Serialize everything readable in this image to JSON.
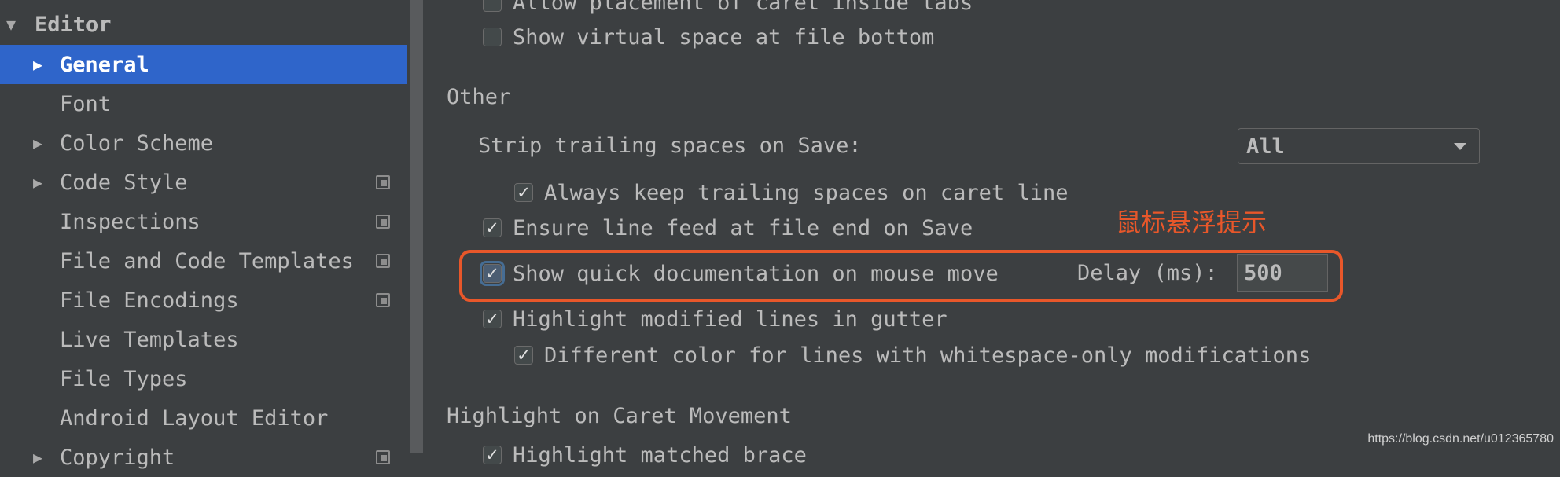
{
  "sidebar": {
    "editor_label": "Editor",
    "items": [
      {
        "label": "General"
      },
      {
        "label": "Font"
      },
      {
        "label": "Color Scheme"
      },
      {
        "label": "Code Style"
      },
      {
        "label": "Inspections"
      },
      {
        "label": "File and Code Templates"
      },
      {
        "label": "File Encodings"
      },
      {
        "label": "Live Templates"
      },
      {
        "label": "File Types"
      },
      {
        "label": "Android Layout Editor"
      },
      {
        "label": "Copyright"
      }
    ]
  },
  "content": {
    "top_options": [
      {
        "label": "Allow placement of caret inside tabs",
        "checked": false
      },
      {
        "label": "Show virtual space at file bottom",
        "checked": false
      }
    ],
    "other": {
      "title": "Other",
      "strip_label": "Strip trailing spaces on Save:",
      "strip_value": "All",
      "keep_trailing": {
        "label": "Always keep trailing spaces on caret line",
        "checked": true
      },
      "ensure_line_feed": {
        "label": "Ensure line feed at file end on Save",
        "checked": true
      },
      "quick_doc": {
        "label": "Show quick documentation on mouse move",
        "checked": true
      },
      "delay_label": "Delay (ms):",
      "delay_value": "500",
      "highlight_modified": {
        "label": "Highlight modified lines in gutter",
        "checked": true
      },
      "different_color": {
        "label": "Different color for lines with whitespace-only modifications",
        "checked": true
      }
    },
    "caret_section": {
      "title": "Highlight on Caret Movement",
      "matched_brace": {
        "label": "Highlight matched brace",
        "checked": true
      }
    }
  },
  "annotation": "鼠标悬浮提示",
  "watermark": "https://blog.csdn.net/u012365780",
  "colors": {
    "selection": "#2f65ca",
    "annotation": "#e8572a",
    "background": "#3c3f41"
  }
}
